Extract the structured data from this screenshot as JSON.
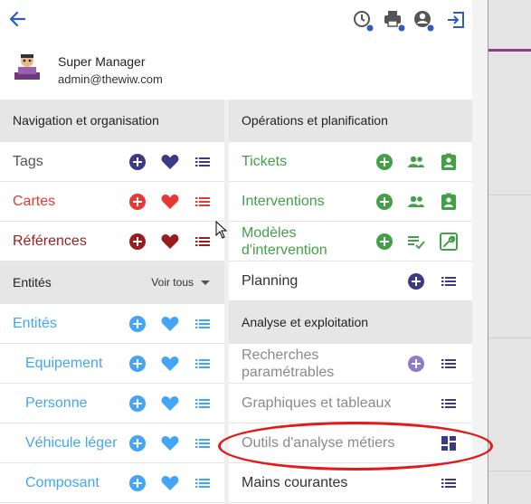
{
  "user": {
    "name": "Super Manager",
    "email": "admin@thewiw.com"
  },
  "top_icons": [
    "back-arrow-icon",
    "clock-settings-icon",
    "printer-settings-icon",
    "account-settings-icon",
    "logout-icon"
  ],
  "colors": {
    "navy": "#3d3a85",
    "red": "#e53935",
    "dark_red": "#9b1c1c",
    "blue": "#42a5f5",
    "green": "#43a047",
    "purple": "#8e7bd0",
    "oval": "#e11a1a"
  },
  "left": {
    "nav_header": "Navigation et organisation",
    "nav_items": [
      {
        "label": "Tags"
      },
      {
        "label": "Cartes"
      },
      {
        "label": "Références"
      }
    ],
    "entities_header": "Entités",
    "entities_dropdown": "Voir tous",
    "entity_items": [
      {
        "label": "Entités"
      },
      {
        "label": "Equipement"
      },
      {
        "label": "Personne"
      },
      {
        "label": "Véhicule léger"
      },
      {
        "label": "Composant"
      }
    ]
  },
  "right": {
    "ops_header": "Opérations et planification",
    "ops_items": [
      {
        "label": "Tickets"
      },
      {
        "label": "Interventions"
      },
      {
        "label_line1": "Modèles",
        "label_line2": "d'intervention"
      },
      {
        "label": "Planning"
      }
    ],
    "analysis_header": "Analyse et exploitation",
    "analysis_items": [
      {
        "label_line1": "Recherches",
        "label_line2": "paramétrables"
      },
      {
        "label": "Graphiques et tableaux"
      },
      {
        "label": "Outils d'analyse métiers"
      },
      {
        "label": "Mains courantes"
      }
    ]
  }
}
